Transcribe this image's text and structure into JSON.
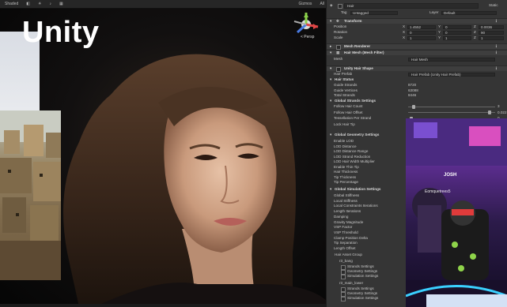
{
  "overlay": {
    "title": "Unity"
  },
  "scene_view": {
    "toolbar": {
      "shading": "Shaded",
      "gizmos": "Gizmos",
      "search": "All"
    },
    "gizmo_label": "< Persp"
  },
  "inspector": {
    "object_name": "Hair",
    "static_label": "Static",
    "tag_label": "Tag",
    "tag_value": "Untagged",
    "layer_label": "Layer",
    "layer_value": "Default",
    "transform": {
      "title": "Transform",
      "position": {
        "label": "Position",
        "x": "1.4552",
        "y": "0",
        "z": "0.0036"
      },
      "rotation": {
        "label": "Rotation",
        "x": "0",
        "y": "0",
        "z": "90"
      },
      "scale": {
        "label": "Scale",
        "x": "1",
        "y": "1",
        "z": "1"
      }
    },
    "mesh_renderer": {
      "title": "Mesh Renderer"
    },
    "mesh_filter": {
      "title": "Hair Mesh (Mesh Filter)",
      "mesh_label": "Mesh",
      "mesh_value": "Hair Mesh"
    },
    "hair_shape": {
      "title": "Unity Hair Shape",
      "hair_prefab_label": "Hair Prefab",
      "hair_prefab_value": "Hair Prefab (Unity Hair Prefab)",
      "status": {
        "title": "Hair Status",
        "rows": [
          {
            "label": "Guide Strands",
            "value": "8720"
          },
          {
            "label": "Guide Vertices",
            "value": "63088"
          },
          {
            "label": "Total Strands",
            "value": "8446"
          }
        ]
      },
      "strand_settings": {
        "title": "Global Strands Settings",
        "rows": [
          {
            "label": "Follow Hair Count",
            "value": "3"
          },
          {
            "label": "Follow Hair Offset",
            "value": "0.022"
          },
          {
            "label": "Tessellation Per Strand",
            "value": "0"
          },
          {
            "label": "Lock Hair Tip",
            "value": ""
          }
        ]
      },
      "geometry_settings": {
        "title": "Global Geometry Settings",
        "rows": [
          "Enable LOD",
          "LOD Distance",
          "LOD Distance Range",
          "LOD Strand Reduction",
          "LOD Hair Width Multiplier",
          "Enable Thin Tip",
          "Hair Thickness",
          "Tip Thickness",
          "Tip Percentage"
        ]
      },
      "simulation_settings": {
        "title": "Global Simulation Settings",
        "rows": [
          "Global Stiffness",
          "Local Stiffness",
          "Local Constraints Iterations",
          "Length Iterations",
          "Damping",
          "Gravity Magnitude",
          "VSP Factor",
          "VSP Threshold",
          "Clamp Position Delta",
          "Tip Separation",
          "Length Offset"
        ]
      },
      "asset_group": {
        "title": "Hair Asset Group",
        "groups": [
          {
            "name": "r3_bang",
            "items": [
              "Strands Settings",
              "Geometry Settings",
              "Simulation Settings"
            ]
          },
          {
            "name": "r3_main_lower",
            "items": [
              "Strands Settings",
              "Geometry Settings",
              "Simulation Settings"
            ]
          }
        ]
      }
    }
  },
  "vr_photo": {
    "name_tag": "JOSH",
    "player_tag": "Eomquetrees5"
  }
}
